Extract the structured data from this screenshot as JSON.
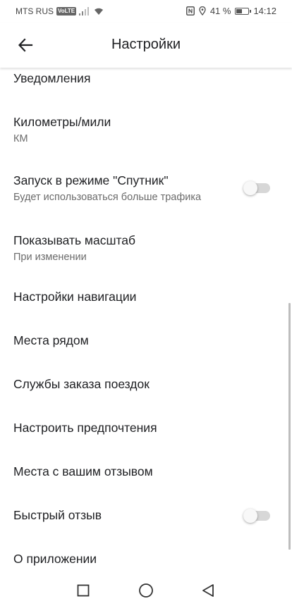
{
  "status_bar": {
    "carrier": "MTS RUS",
    "volte": "VoLTE",
    "battery_percent": "41 %",
    "battery_level": 0.41,
    "time": "14:12",
    "icons": [
      "signal-icon",
      "wifi-icon",
      "nfc-icon",
      "location-icon",
      "battery-icon"
    ]
  },
  "header": {
    "title": "Настройки",
    "back_icon": "arrow-back-icon"
  },
  "settings": {
    "notifications": {
      "title": "Уведомления"
    },
    "units": {
      "title": "Километры/мили",
      "value": "КМ"
    },
    "satellite": {
      "title": "Запуск в режиме \"Спутник\"",
      "subtitle": "Будет использоваться больше трафика",
      "enabled": false
    },
    "scale": {
      "title": "Показывать масштаб",
      "value": "При изменении"
    },
    "navigation": {
      "title": "Настройки навигации"
    },
    "nearby": {
      "title": "Места рядом"
    },
    "rides": {
      "title": "Службы заказа поездок"
    },
    "preferences": {
      "title": "Настроить предпочтения"
    },
    "reviewed": {
      "title": "Места с вашим отзывом"
    },
    "quick_review": {
      "title": "Быстрый отзыв",
      "enabled": false
    },
    "about": {
      "title": "О приложении"
    }
  },
  "nav_bar": {
    "icons": [
      "recent-apps-icon",
      "home-icon",
      "back-triangle-icon"
    ]
  }
}
